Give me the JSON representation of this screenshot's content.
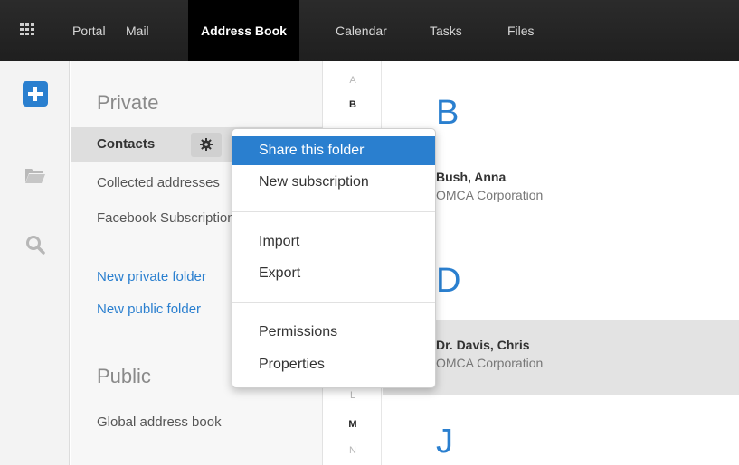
{
  "topbar": {
    "apps_icon": "grid-icon",
    "nav": [
      "Portal",
      "Mail",
      "Address Book",
      "Calendar",
      "Tasks",
      "Files"
    ],
    "active": "Address Book"
  },
  "rail": {
    "add_icon": "plus-icon",
    "folder_icon": "folder-open-icon",
    "search_icon": "search-icon"
  },
  "tree": {
    "private_title": "Private",
    "contacts": "Contacts",
    "collected": "Collected addresses",
    "facebook": "Facebook Subscription",
    "new_private": "New private folder",
    "new_public": "New public folder",
    "public_title": "Public",
    "global": "Global address book"
  },
  "alphabet": {
    "letters": [
      "A",
      "B",
      "L",
      "M",
      "N"
    ],
    "bold_letters": [
      "B",
      "M"
    ]
  },
  "list": {
    "groups": [
      {
        "letter": "B",
        "contacts": [
          {
            "name": "Bush, Anna",
            "company": "OMCA Corporation"
          }
        ]
      },
      {
        "letter": "D",
        "contacts": [
          {
            "name": "Dr. Davis, Chris",
            "company": "OMCA Corporation",
            "selected": true
          }
        ]
      },
      {
        "letter": "J",
        "contacts": []
      }
    ]
  },
  "menu": {
    "share": "Share this folder",
    "subscription": "New subscription",
    "import": "Import",
    "export": "Export",
    "permissions": "Permissions",
    "properties": "Properties"
  },
  "colors": {
    "accent": "#2a7fcf",
    "topbar": "#222222",
    "selected_row": "#e3e3e3"
  }
}
